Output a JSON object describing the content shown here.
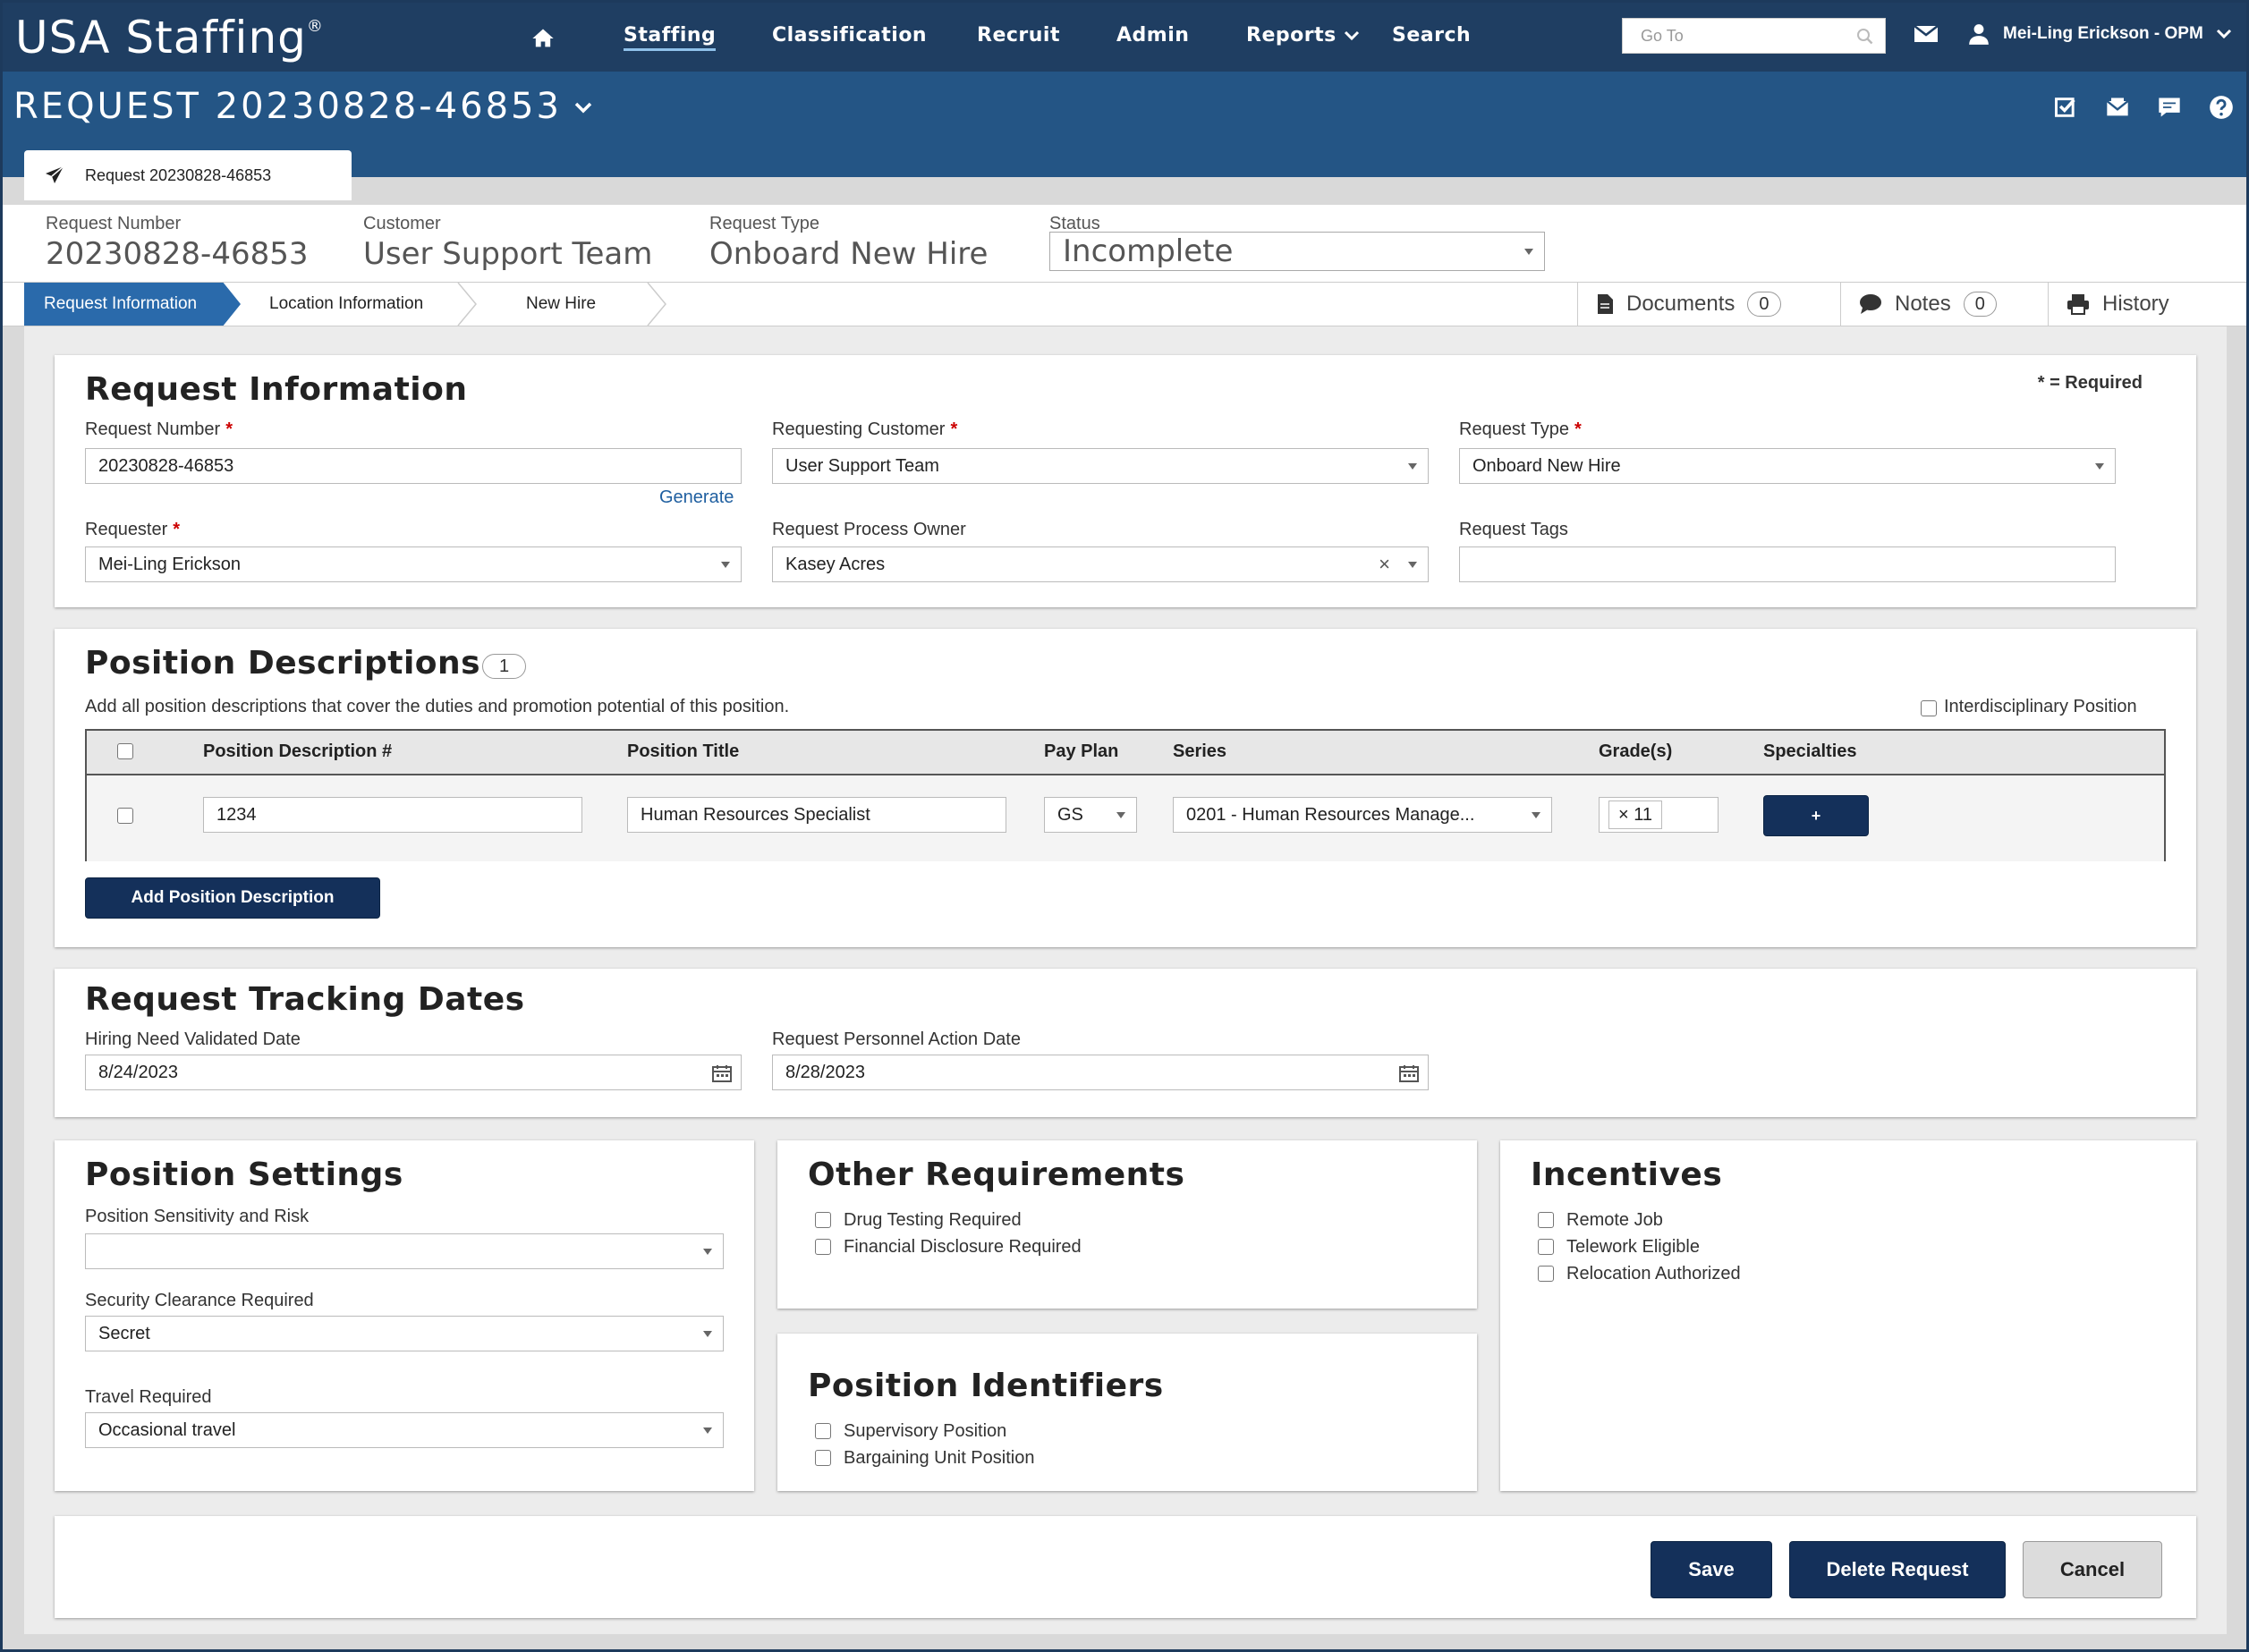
{
  "app": {
    "logo": "USA Staffing",
    "logo_mark": "®"
  },
  "nav": {
    "items": [
      "Staffing",
      "Classification",
      "Recruit",
      "Admin",
      "Reports",
      "Search"
    ],
    "goto_placeholder": "Go To",
    "user": "Mei-Ling Erickson - OPM"
  },
  "request": {
    "title": "REQUEST 20230828-46853",
    "tab_label": "Request 20230828-46853",
    "summary": {
      "number_label": "Request Number",
      "number": "20230828-46853",
      "customer_label": "Customer",
      "customer": "User Support Team",
      "type_label": "Request Type",
      "type": "Onboard New Hire",
      "status_label": "Status",
      "status": "Incomplete"
    }
  },
  "wizard": {
    "steps": [
      "Request Information",
      "Location Information",
      "New Hire"
    ]
  },
  "tabs": {
    "documents": {
      "label": "Documents",
      "count": "0"
    },
    "notes": {
      "label": "Notes",
      "count": "0"
    },
    "history": {
      "label": "History"
    }
  },
  "request_info": {
    "title": "Request Information",
    "required_note": "* = Required",
    "request_number": {
      "label": "Request Number",
      "value": "20230828-46853",
      "link": "Generate"
    },
    "requesting_customer": {
      "label": "Requesting Customer",
      "value": "User Support Team"
    },
    "request_type": {
      "label": "Request Type",
      "value": "Onboard New Hire"
    },
    "requester": {
      "label": "Requester",
      "value": "Mei-Ling Erickson"
    },
    "process_owner": {
      "label": "Request Process Owner",
      "value": "Kasey Acres"
    },
    "tags": {
      "label": "Request Tags",
      "value": ""
    }
  },
  "position_descriptions": {
    "title": "Position Descriptions",
    "count": "1",
    "help": "Add all position descriptions that cover the duties and promotion potential of this position.",
    "interdisciplinary": "Interdisciplinary Position",
    "columns": [
      "Position Description #",
      "Position Title",
      "Pay Plan",
      "Series",
      "Grade(s)",
      "Specialties"
    ],
    "row": {
      "pd_number": "1234",
      "title": "Human Resources Specialist",
      "pay_plan": "GS",
      "series": "0201 - Human Resources Manage...",
      "grade": "11",
      "specialties_button": "+"
    },
    "add_button": "Add Position Description"
  },
  "tracking": {
    "title": "Request Tracking Dates",
    "hiring_label": "Hiring Need Validated Date",
    "hiring_value": "8/24/2023",
    "pa_label": "Request Personnel Action Date",
    "pa_value": "8/28/2023"
  },
  "position_settings": {
    "title": "Position Settings",
    "sensitivity": {
      "label": "Position Sensitivity and Risk",
      "value": ""
    },
    "clearance": {
      "label": "Security Clearance Required",
      "value": "Secret"
    },
    "travel": {
      "label": "Travel Required",
      "value": "Occasional travel"
    }
  },
  "other_requirements": {
    "title": "Other Requirements",
    "items": [
      "Drug Testing Required",
      "Financial Disclosure Required"
    ]
  },
  "position_identifiers": {
    "title": "Position Identifiers",
    "items": [
      "Supervisory Position",
      "Bargaining Unit Position"
    ]
  },
  "incentives": {
    "title": "Incentives",
    "items": [
      "Remote Job",
      "Telework Eligible",
      "Relocation Authorized"
    ]
  },
  "actions": {
    "save": "Save",
    "delete": "Delete Request",
    "cancel": "Cancel"
  }
}
